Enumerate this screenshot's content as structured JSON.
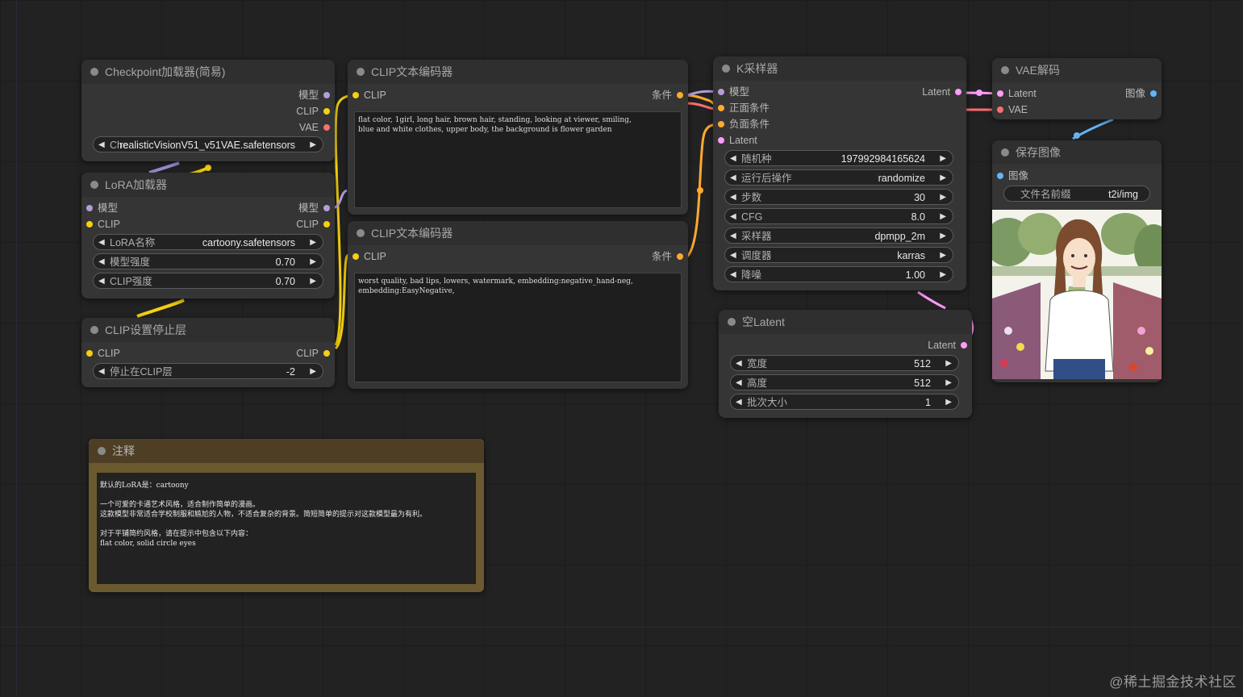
{
  "nodes": {
    "checkpoint": {
      "title": "Checkpoint加载器(简易)",
      "outputs": [
        "模型",
        "CLIP",
        "VAE"
      ],
      "ckpt_label": "Che",
      "ckpt_value": "realisticVisionV51_v51VAE.safetensors"
    },
    "lora": {
      "title": "LoRA加载器",
      "inputs": [
        "模型",
        "CLIP"
      ],
      "outputs": [
        "模型",
        "CLIP"
      ],
      "widgets": [
        {
          "label": "LoRA名称",
          "value": "cartoony.safetensors"
        },
        {
          "label": "模型强度",
          "value": "0.70"
        },
        {
          "label": "CLIP强度",
          "value": "0.70"
        }
      ]
    },
    "clip_stop": {
      "title": "CLIP设置停止层",
      "input": "CLIP",
      "output": "CLIP",
      "widget": {
        "label": "停止在CLIP层",
        "value": "-2"
      }
    },
    "clip_pos": {
      "title": "CLIP文本编码器",
      "input": "CLIP",
      "output": "条件",
      "text": "flat color, 1girl, long hair, brown hair, standing, looking at viewer, smiling,\nblue and white clothes, upper body, the background is flower garden"
    },
    "clip_neg": {
      "title": "CLIP文本编码器",
      "input": "CLIP",
      "output": "条件",
      "text": "worst quality, bad lips, lowers, watermark, embedding:negative_hand-neg,\nembedding:EasyNegative,"
    },
    "ksampler": {
      "title": "K采样器",
      "inputs": [
        "模型",
        "正面条件",
        "负面条件",
        "Latent"
      ],
      "output": "Latent",
      "widgets": [
        {
          "label": "随机种",
          "value": "197992984165624"
        },
        {
          "label": "运行后操作",
          "value": "randomize"
        },
        {
          "label": "步数",
          "value": "30"
        },
        {
          "label": "CFG",
          "value": "8.0"
        },
        {
          "label": "采样器",
          "value": "dpmpp_2m"
        },
        {
          "label": "调度器",
          "value": "karras"
        },
        {
          "label": "降噪",
          "value": "1.00"
        }
      ]
    },
    "empty_latent": {
      "title": "空Latent",
      "output": "Latent",
      "widgets": [
        {
          "label": "宽度",
          "value": "512"
        },
        {
          "label": "高度",
          "value": "512"
        },
        {
          "label": "批次大小",
          "value": "1"
        }
      ]
    },
    "vae_decode": {
      "title": "VAE解码",
      "inputs": [
        "Latent",
        "VAE"
      ],
      "output": "图像"
    },
    "save_image": {
      "title": "保存图像",
      "input": "图像",
      "widget": {
        "label": "文件名前缀",
        "value": "t2i/img"
      }
    },
    "note": {
      "title": "注释",
      "text": "默认的LoRA是：cartoony\n\n一个可爱的卡通艺术风格，适合制作简单的漫画。\n这款模型非常适合学校制服和尴尬的人物，不适合复杂的背景。简短简单的提示对这款模型最为有利。\n\n对于平铺简约风格，请在提示中包含以下内容：\nflat color, solid circle eyes"
    }
  },
  "colors": {
    "model": "#b39ddb",
    "clip": "#f5d011",
    "vae": "#ff6e6e",
    "conditioning": "#ffa931",
    "latent": "#ff9cf9",
    "image": "#64b5f6"
  },
  "watermark": "@稀土掘金技术社区"
}
